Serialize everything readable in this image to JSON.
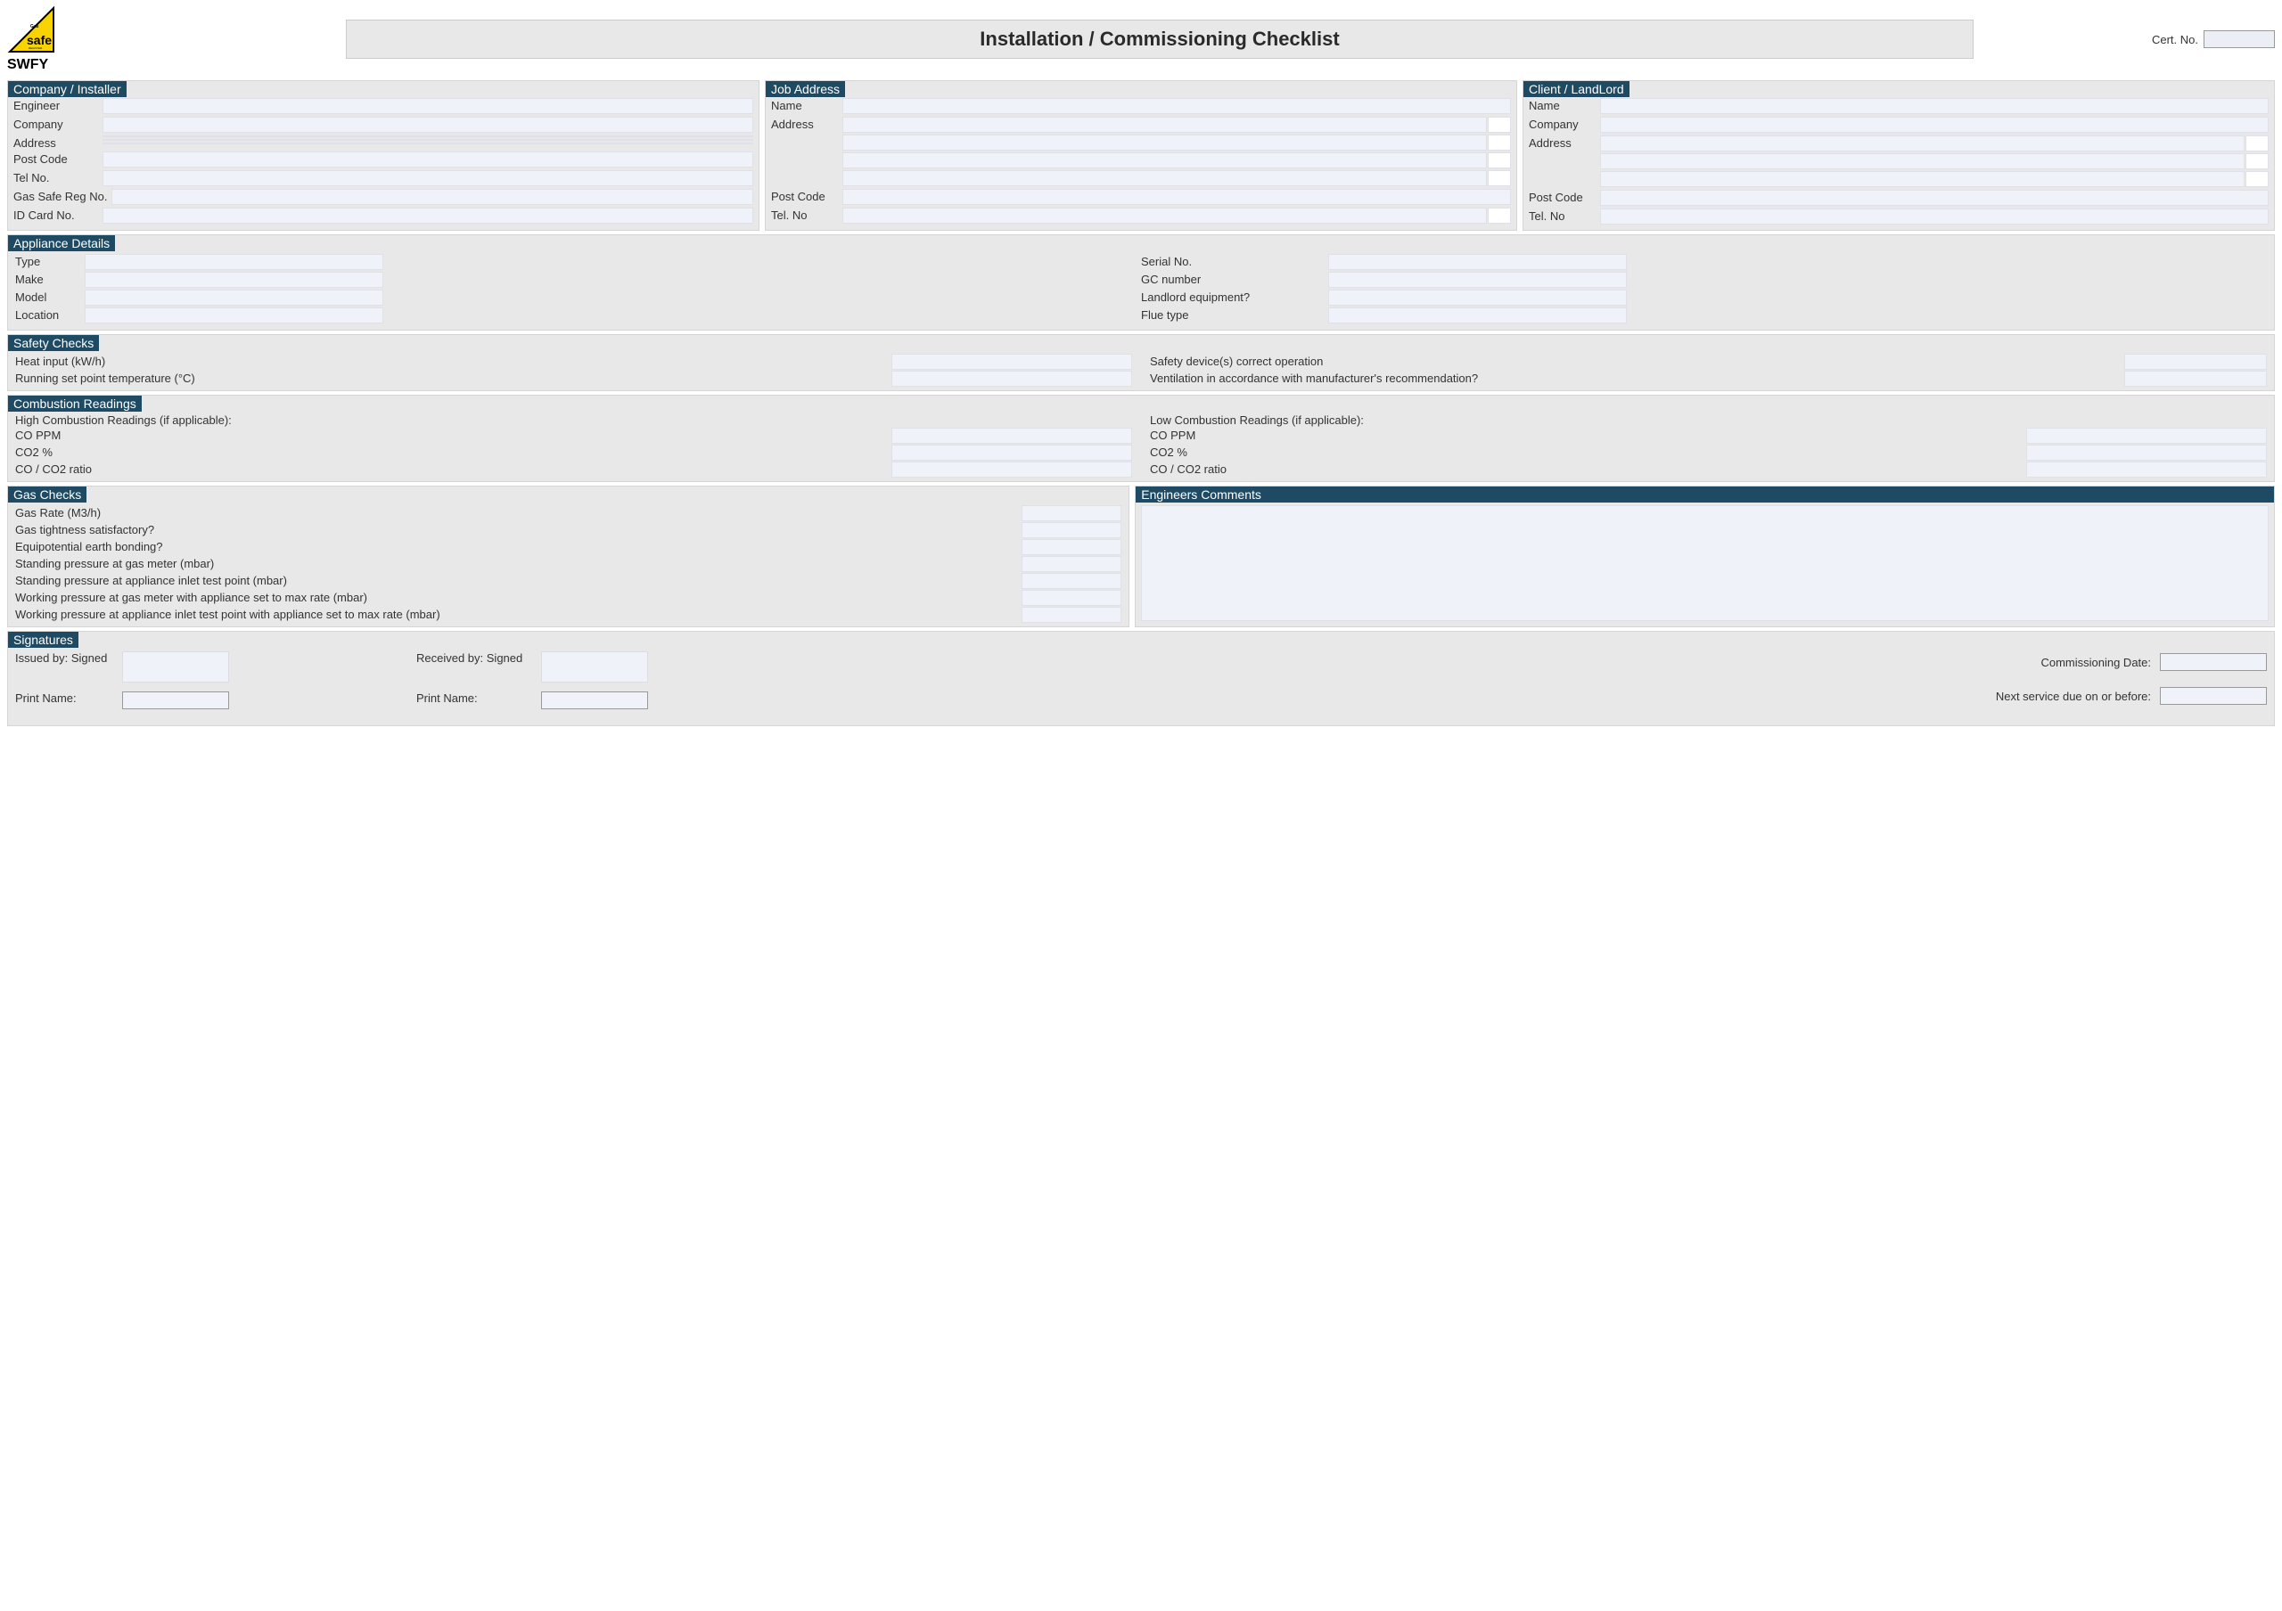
{
  "header": {
    "title": "Installation / Commissioning Checklist",
    "cert_label": "Cert. No.",
    "logo_text": "safe",
    "logo_sub": "SWFY"
  },
  "company": {
    "header": "Company / Installer",
    "engineer_label": "Engineer",
    "company_label": "Company",
    "address_label": "Address",
    "postcode_label": "Post Code",
    "tel_label": "Tel No.",
    "gassafe_label": "Gas Safe Reg No.",
    "idcard_label": "ID Card No."
  },
  "job": {
    "header": "Job Address",
    "name_label": "Name",
    "address_label": "Address",
    "postcode_label": "Post Code",
    "tel_label": "Tel. No"
  },
  "client": {
    "header": "Client / LandLord",
    "name_label": "Name",
    "company_label": "Company",
    "address_label": "Address",
    "postcode_label": "Post Code",
    "tel_label": "Tel. No"
  },
  "appliance": {
    "header": "Appliance Details",
    "type_label": "Type",
    "make_label": "Make",
    "model_label": "Model",
    "location_label": "Location",
    "serial_label": "Serial No.",
    "gc_label": "GC number",
    "landlord_label": "Landlord equipment?",
    "flue_label": "Flue type"
  },
  "safety": {
    "header": "Safety Checks",
    "heat_label": "Heat input (kW/h)",
    "running_label": "Running set point temperature (°C)",
    "safety_dev_label": "Safety device(s) correct operation",
    "vent_label": "Ventilation in accordance with manufacturer's recommendation?"
  },
  "combustion": {
    "header": "Combustion Readings",
    "high_header": "High Combustion Readings (if applicable):",
    "low_header": "Low Combustion Readings (if applicable):",
    "co_ppm": "CO PPM",
    "co2_pct": "CO2 %",
    "ratio": "CO / CO2 ratio"
  },
  "gas": {
    "header": "Gas Checks",
    "rate_label": "Gas Rate (M3/h)",
    "tightness_label": "Gas tightness satisfactory?",
    "bonding_label": "Equipotential earth bonding?",
    "standing_meter_label": "Standing pressure at gas meter (mbar)",
    "standing_inlet_label": "Standing pressure at appliance inlet test point (mbar)",
    "working_meter_label": "Working pressure at gas meter with appliance set to max rate (mbar)",
    "working_inlet_label": "Working pressure at appliance inlet test point with appliance set to max rate (mbar)"
  },
  "comments": {
    "header": "Engineers Comments"
  },
  "signatures": {
    "header": "Signatures",
    "issued_label": "Issued by: Signed",
    "received_label": "Received by: Signed",
    "print_label": "Print Name:",
    "comm_date_label": "Commissioning Date:",
    "next_service_label": "Next service due on or before:"
  }
}
